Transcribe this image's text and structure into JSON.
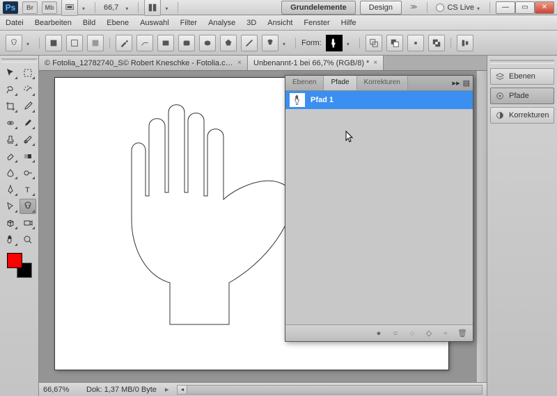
{
  "topbar": {
    "ps": "Ps",
    "badges": [
      "Br",
      "Mb"
    ],
    "zoom": "66,7",
    "workspace_active": "Grundelemente",
    "workspace_other": "Design",
    "cslive": "CS Live"
  },
  "menu": [
    "Datei",
    "Bearbeiten",
    "Bild",
    "Ebene",
    "Auswahl",
    "Filter",
    "Analyse",
    "3D",
    "Ansicht",
    "Fenster",
    "Hilfe"
  ],
  "options": {
    "form_label": "Form:"
  },
  "tabs": {
    "t1": "© Fotolia_12782740_S© Robert Kneschke - Fotolia.com.jpg bei ...",
    "t2": "Unbenannt-1 bei 66,7% (RGB/8) *"
  },
  "panel": {
    "tab_ebenen": "Ebenen",
    "tab_pfade": "Pfade",
    "tab_korr": "Korrekturen",
    "path1": "Pfad 1"
  },
  "dock": {
    "ebenen": "Ebenen",
    "pfade": "Pfade",
    "korrekturen": "Korrekturen"
  },
  "status": {
    "zoom": "66,67%",
    "dok": "Dok: 1,37 MB/0 Byte"
  }
}
